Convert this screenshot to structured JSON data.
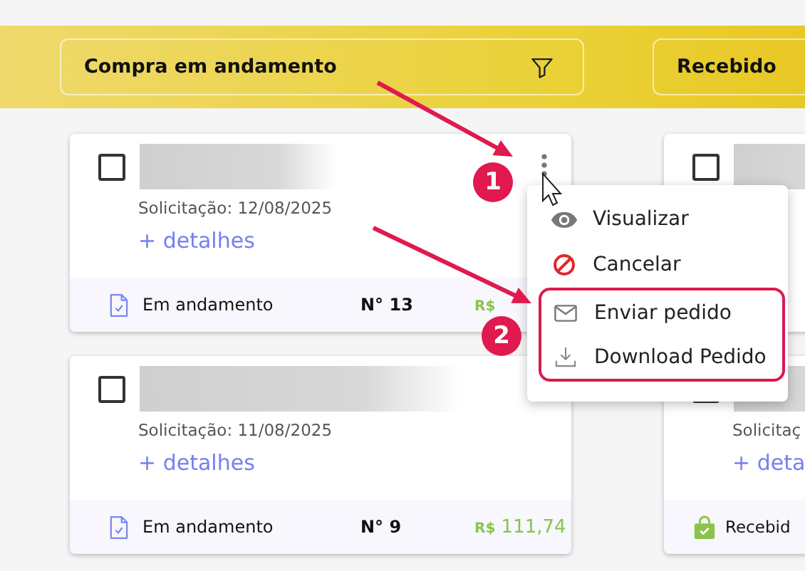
{
  "columns": [
    {
      "title": "Compra em andamento",
      "filter": true,
      "cards": [
        {
          "checked": false,
          "date": "Solicitação: 12/08/2025",
          "details_link": "+ detalhes",
          "status": "Em andamento",
          "kind": "document",
          "number": "N° 13",
          "currency": "R$"
        },
        {
          "checked": false,
          "date": "Solicitação: 11/08/2025",
          "details_link": "+ detalhes",
          "status": "Em andamento",
          "kind": "document",
          "number": "N° 9",
          "currency": "R$",
          "amount": "111,74"
        }
      ]
    },
    {
      "title": "Recebido",
      "cards": [
        {
          "checked": false
        },
        {
          "checked": false,
          "date": "Solicitaç",
          "details_link": "+ deta",
          "status": "Recebid",
          "kind": "bag"
        }
      ]
    }
  ],
  "menu": {
    "items": [
      {
        "label": "Visualizar",
        "kind": "view",
        "highlighted": false
      },
      {
        "label": "Cancelar",
        "kind": "cancel",
        "highlighted": false
      },
      {
        "label": "Enviar pedido",
        "kind": "send",
        "highlighted": true
      },
      {
        "label": "Download Pedido",
        "kind": "download",
        "highlighted": true
      }
    ]
  },
  "annotations": [
    {
      "label": "1"
    },
    {
      "label": "2"
    }
  ]
}
